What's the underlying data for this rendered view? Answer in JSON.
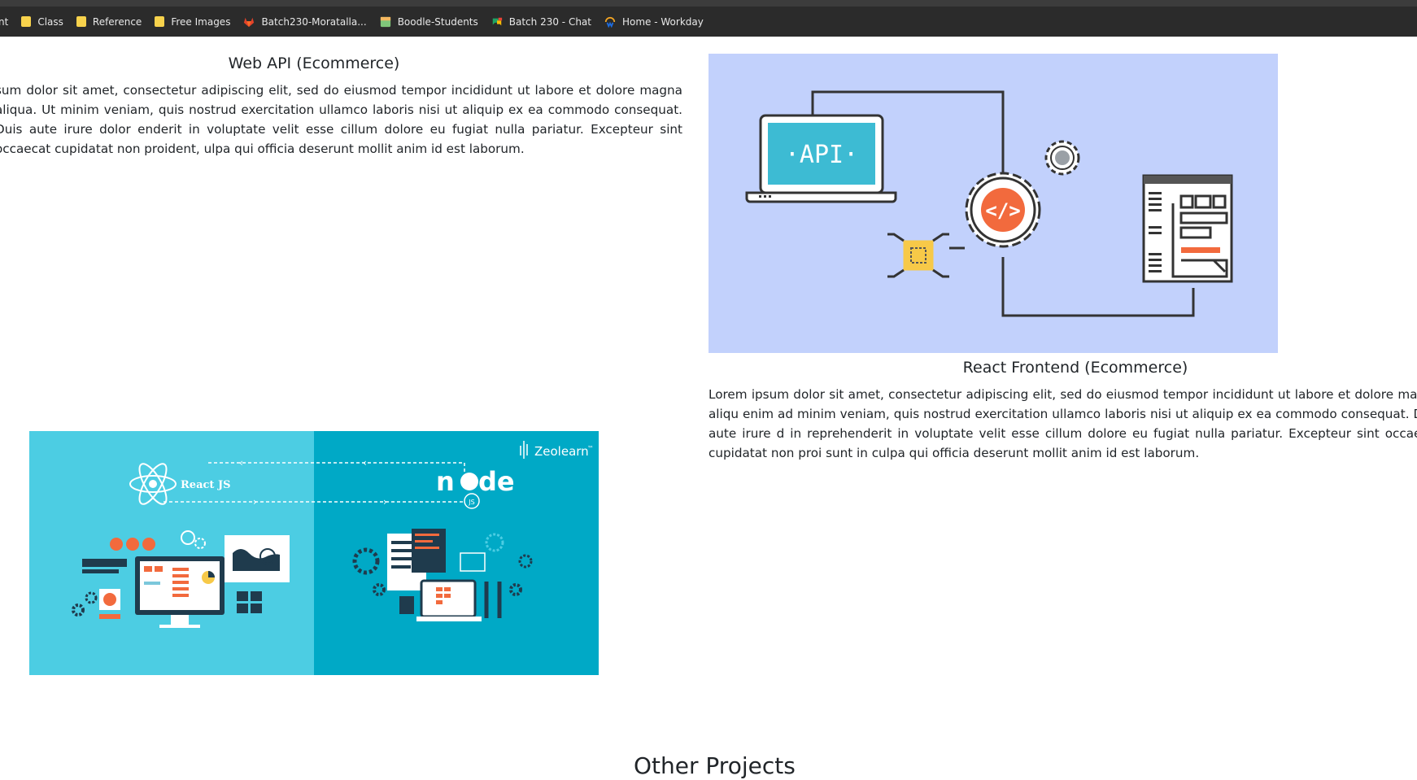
{
  "bookmarks": [
    {
      "label": "nt",
      "icon": "none"
    },
    {
      "label": "Class",
      "icon": "folder-icon"
    },
    {
      "label": "Reference",
      "icon": "folder-icon"
    },
    {
      "label": "Free Images",
      "icon": "folder-icon"
    },
    {
      "label": "Batch230-Moratalla...",
      "icon": "gitlab-icon"
    },
    {
      "label": "Boodle-Students",
      "icon": "sheet-icon"
    },
    {
      "label": "Batch 230 - Chat",
      "icon": "chat-icon"
    },
    {
      "label": "Home - Workday",
      "icon": "workday-icon"
    }
  ],
  "projects": [
    {
      "title": "Web API (Ecommerce)",
      "description": "sum dolor sit amet, consectetur adipiscing elit, sed do eiusmod tempor incididunt ut labore et dolore magna aliqua. Ut minim veniam, quis nostrud exercitation ullamco laboris nisi ut aliquip ex ea commodo consequat. Duis aute irure dolor enderit in voluptate velit esse cillum dolore eu fugiat nulla pariatur. Excepteur sint occaecat cupidatat non proident, ulpa qui officia deserunt mollit anim id est laborum.",
      "image_text": "·API·"
    },
    {
      "title": "React Frontend (Ecommerce)",
      "description": "Lorem ipsum dolor sit amet, consectetur adipiscing elit, sed do eiusmod tempor incididunt ut labore et dolore magna aliqu enim ad minim veniam, quis nostrud exercitation ullamco laboris nisi ut aliquip ex ea commodo consequat. Duis aute irure d in reprehenderit in voluptate velit esse cillum dolore eu fugiat nulla pariatur. Excepteur sint occaecat cupidatat non proi sunt in culpa qui officia deserunt mollit anim id est laborum.",
      "image_labels": {
        "left": "React JS",
        "brand": "Zeolearn",
        "brand_tm": "™",
        "right_a": "n",
        "right_b": "de",
        "right_c": "JS"
      }
    }
  ],
  "other_projects_heading": "Other Projects",
  "colors": {
    "api_bg": "#c2d1fc",
    "react_left": "#4ccde3",
    "react_right": "#00a9c6",
    "accent_orange": "#f26a3d"
  }
}
